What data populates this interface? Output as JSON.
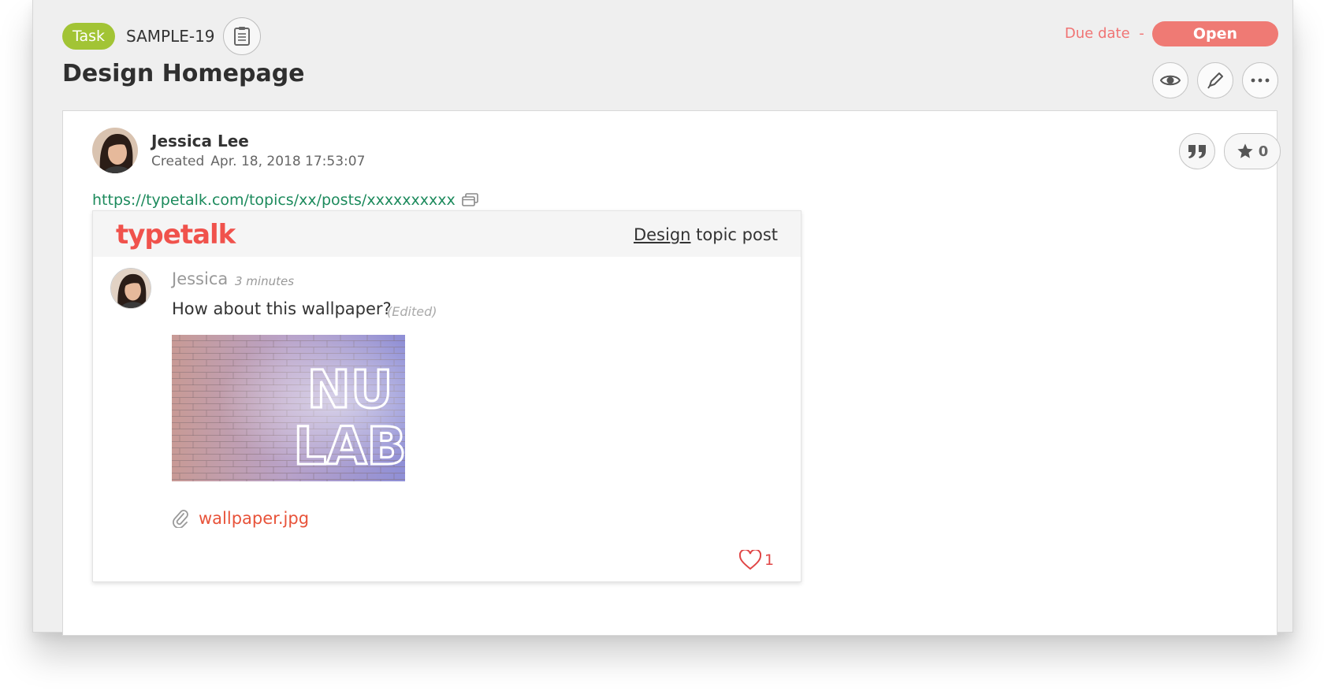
{
  "issue": {
    "type_label": "Task",
    "key": "SAMPLE-19",
    "title": "Design Homepage",
    "due_label": "Due date",
    "due_value": "-",
    "status": "Open"
  },
  "actions": {
    "copy_icon": "clipboard-icon",
    "watch_icon": "eye-icon",
    "edit_icon": "pencil-icon",
    "more_icon": "more-icon"
  },
  "comment": {
    "author": "Jessica Lee",
    "created_label": "Created",
    "created_date": "Apr. 18, 2018 17:53:07",
    "star_count": "0",
    "link": "https://typetalk.com/topics/xx/posts/xxxxxxxxxx",
    "embed": {
      "logo": "typetalk",
      "topic_name": "Design",
      "topic_suffix": "topic post",
      "post_author": "Jessica",
      "post_time": "3 minutes",
      "post_text": "How about this wallpaper?",
      "edited_label": "(Edited)",
      "image_text": "NULAB",
      "attachment": "wallpaper.jpg",
      "like_count": "1"
    }
  },
  "colors": {
    "task_badge": "#a2c435",
    "status_open": "#ef7a74",
    "due_label": "#f07474",
    "link": "#1c8a5c",
    "typetalk_brand": "#f0524c",
    "attachment": "#e8533a",
    "like": "#e04545"
  }
}
